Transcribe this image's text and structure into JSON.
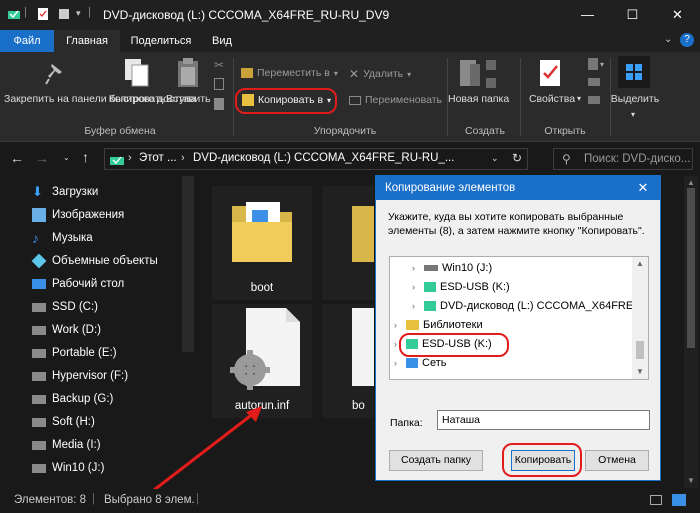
{
  "window": {
    "title": "DVD-дисковод (L:) CCCOMA_X64FRE_RU-RU_DV9",
    "controls": {
      "minimize": "—",
      "maximize": "☐",
      "close": "✕"
    }
  },
  "tabs": [
    "Файл",
    "Главная",
    "Поделиться",
    "Вид"
  ],
  "ribbon": {
    "pin": "Закрепить на панели быстрого доступа",
    "copy": "Копировать",
    "paste": "Вставить",
    "move_to": "Переместить в",
    "copy_to": "Копировать в",
    "delete": "Удалить",
    "rename": "Переименовать",
    "new_folder": "Новая папка",
    "properties": "Свойства",
    "select": "Выделить",
    "groups": {
      "clipboard": "Буфер обмена",
      "organize": "Упорядочить",
      "create": "Создать",
      "open": "Открыть"
    }
  },
  "address": {
    "crumb1": "Этот ...",
    "crumb2": "DVD-дисковод (L:) CCCOMA_X64FRE_RU-RU_...",
    "search_placeholder": "Поиск: DVD-диско..."
  },
  "sidebar": [
    {
      "label": "Загрузки",
      "icon": "download-icon",
      "color": "#3aa0ff"
    },
    {
      "label": "Изображения",
      "icon": "pictures-icon",
      "color": "#6ab0e6"
    },
    {
      "label": "Музыка",
      "icon": "music-icon",
      "color": "#3a8fe6"
    },
    {
      "label": "Объемные объекты",
      "icon": "3d-objects-icon",
      "color": "#5cc6e8"
    },
    {
      "label": "Рабочий стол",
      "icon": "desktop-icon",
      "color": "#3a8fe6"
    },
    {
      "label": "SSD (C:)",
      "icon": "drive-icon",
      "color": "#9a9a9a"
    },
    {
      "label": "Work (D:)",
      "icon": "drive-icon",
      "color": "#9a9a9a"
    },
    {
      "label": "Portable (E:)",
      "icon": "drive-icon",
      "color": "#9a9a9a"
    },
    {
      "label": "Hypervisor (F:)",
      "icon": "drive-icon",
      "color": "#9a9a9a"
    },
    {
      "label": "Backup (G:)",
      "icon": "drive-icon",
      "color": "#9a9a9a"
    },
    {
      "label": "Soft (H:)",
      "icon": "drive-icon",
      "color": "#9a9a9a"
    },
    {
      "label": "Media (I:)",
      "icon": "drive-icon",
      "color": "#9a9a9a"
    },
    {
      "label": "Win10 (J:)",
      "icon": "drive-icon",
      "color": "#9a9a9a"
    }
  ],
  "files": {
    "boot": "boot",
    "autorun": "autorun.inf",
    "partial": "bo"
  },
  "status": {
    "count": "Элементов: 8",
    "selected": "Выбрано 8 элем."
  },
  "dialog": {
    "title": "Копирование элементов",
    "close": "✕",
    "description": "Укажите, куда вы хотите копировать выбранные элементы (8), а затем нажмите кнопку \"Копировать\".",
    "tree": [
      {
        "label": "Win10 (J:)"
      },
      {
        "label": "ESD-USB (K:)"
      },
      {
        "label": "DVD-дисковод (L:) CCCOMA_X64FRE"
      },
      {
        "label": "Библиотеки"
      },
      {
        "label": "ESD-USB (K:)"
      },
      {
        "label": "Сеть"
      }
    ],
    "folder_label": "Папка:",
    "folder_value": "Наташа",
    "btn_new_folder": "Создать папку",
    "btn_copy": "Копировать",
    "btn_cancel": "Отмена"
  },
  "colors": {
    "accent": "#1a6fc9",
    "highlight_ring": "#e21b1b"
  }
}
